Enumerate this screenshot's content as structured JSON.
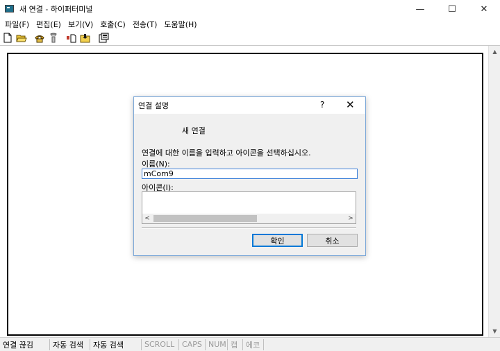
{
  "window": {
    "title": "새 연결 - 하이퍼터미널",
    "minimize": "—",
    "maximize": "☐",
    "close": "✕"
  },
  "menu": [
    "파일(F)",
    "편집(E)",
    "보기(V)",
    "호출(C)",
    "전송(T)",
    "도움말(H)"
  ],
  "toolbar": {
    "icons": [
      "new-file-icon",
      "open-folder-icon",
      "call-icon",
      "disconnect-icon",
      "send-icon",
      "receive-icon",
      "properties-icon"
    ]
  },
  "dialog": {
    "title": "연결 설명",
    "help": "?",
    "close": "✕",
    "heading": "새 연결",
    "description": "연결에 대한 이름을 입력하고 아이콘을 선택하십시오.",
    "name_label": "이름(N):",
    "name_value": "mCom9",
    "icon_label": "아이콘(I):",
    "ok": "확인",
    "cancel": "취소"
  },
  "status": {
    "connection": "연결 끊김",
    "auto1": "자동 검색",
    "auto2": "자동 검색",
    "scroll": "SCROLL",
    "caps": "CAPS",
    "num": "NUM",
    "capture": "캡",
    "echo": "에코"
  },
  "colors": {
    "accent": "#0078d7",
    "dialog_border": "#7aa7d8",
    "disabled_text": "#9a9a9a"
  }
}
